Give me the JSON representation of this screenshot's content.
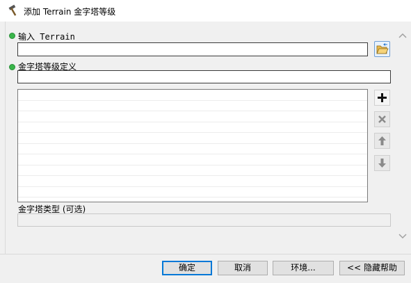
{
  "window": {
    "title": "添加 Terrain 金字塔等级"
  },
  "form": {
    "input_terrain_label": "输入 Terrain",
    "input_terrain_value": "",
    "pyramid_def_label": "金字塔等级定义",
    "pyramid_def_value": "",
    "pyramid_type_label": "金字塔类型 (可选)",
    "pyramid_type_value": "",
    "list_rows": [
      "",
      "",
      "",
      "",
      "",
      "",
      "",
      "",
      "",
      ""
    ]
  },
  "icons": {
    "title": "hammer-icon",
    "browse": "open-folder-icon",
    "add": "plus-icon",
    "remove": "x-icon",
    "move_up": "arrow-up-icon",
    "move_down": "arrow-down-icon",
    "required": "green-dot-icon"
  },
  "buttons": {
    "ok": "确定",
    "cancel": "取消",
    "environments": "环境...",
    "hide_help": "<< 隐藏帮助"
  },
  "colors": {
    "required_dot": "#39b54a",
    "default_button_border": "#0078d7"
  }
}
